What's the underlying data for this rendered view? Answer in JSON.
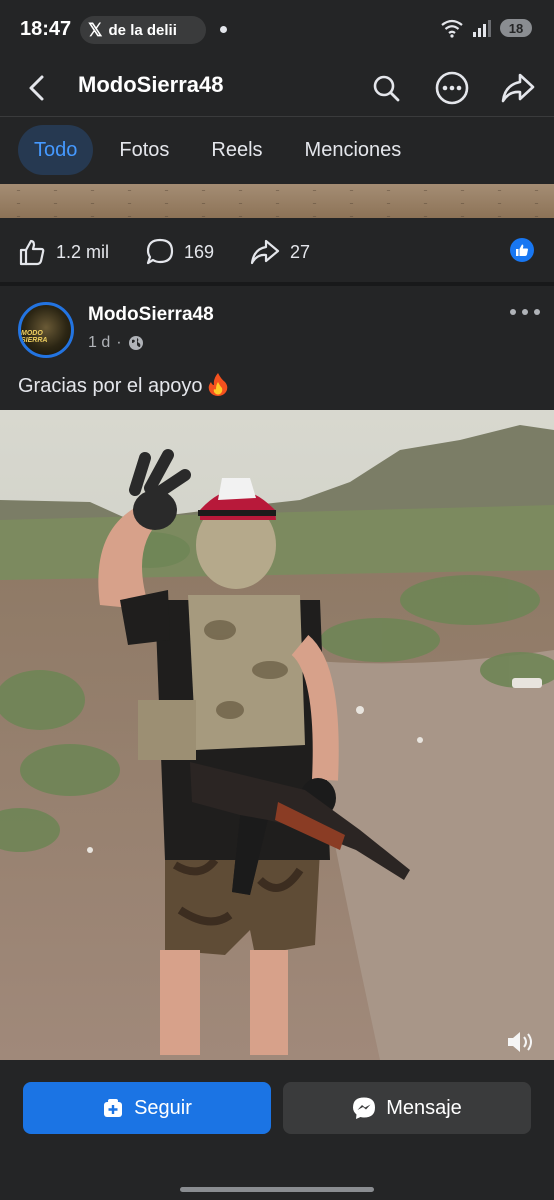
{
  "status_bar": {
    "time": "18:47",
    "notification_text": "de la delii",
    "network": "5",
    "battery": "18"
  },
  "nav": {
    "title": "ModoSierra48"
  },
  "tabs": [
    {
      "label": "Todo",
      "active": true
    },
    {
      "label": "Fotos",
      "active": false
    },
    {
      "label": "Reels",
      "active": false
    },
    {
      "label": "Menciones",
      "active": false
    }
  ],
  "previous_post": {
    "likes": "1.2 mil",
    "comments": "169",
    "shares": "27"
  },
  "post": {
    "author": "ModoSierra48",
    "avatar_text": "MODO SIERRA",
    "time": "1 d",
    "visibility_icon": "globe-icon",
    "caption": "Gracias por el apoyo"
  },
  "actions": {
    "follow_label": "Seguir",
    "message_label": "Mensaje"
  },
  "colors": {
    "accent": "#1b74e4",
    "background": "#242526",
    "active_tab_bg": "#263951",
    "active_tab_text": "#4599ff"
  }
}
